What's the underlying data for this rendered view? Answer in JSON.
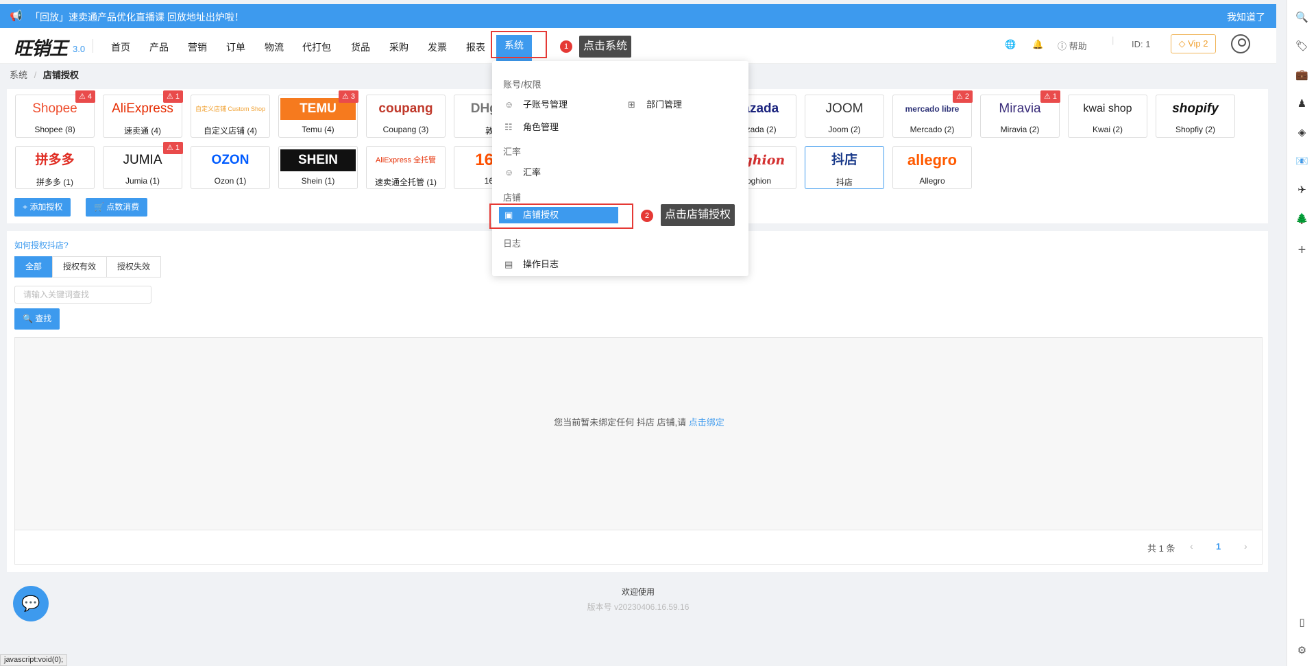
{
  "announcement": {
    "text": "「回放」速卖通产品优化直播课 回放地址出炉啦！",
    "close_label": "我知道了"
  },
  "nav": {
    "logo_text": "旺销王",
    "version": "3.0",
    "items": [
      "首页",
      "产品",
      "营销",
      "订单",
      "物流",
      "代打包",
      "货品",
      "采购",
      "发票",
      "报表",
      "系统"
    ],
    "help_label": "帮助",
    "user_id": "ID: 1",
    "vip_label": "Vip 2"
  },
  "breadcrumb": {
    "root": "系统",
    "current": "店铺授权"
  },
  "shops": [
    {
      "logo": "Shopee",
      "name": "Shopee (8)",
      "badge": "4",
      "color": "#ee4d2d"
    },
    {
      "logo": "AliExpress",
      "name": "速卖通 (4)",
      "badge": "1",
      "color": "#e62e04"
    },
    {
      "logo": "自定义店铺 Custom Shop",
      "name": "自定义店铺 (4)",
      "badge": "",
      "color": "#f0a030"
    },
    {
      "logo": "TEMU",
      "name": "Temu (4)",
      "badge": "3",
      "color": "#ffffff"
    },
    {
      "logo": "coupang",
      "name": "Coupang (3)",
      "badge": "",
      "color": "#c0392b"
    },
    {
      "logo": "DHgate",
      "name": "敦煌",
      "badge": "",
      "color": "#777777"
    },
    {
      "logo": "Lazada",
      "name": "Lazada (2)",
      "badge": "",
      "color": "#1a237e"
    },
    {
      "logo": "JOOM",
      "name": "Joom (2)",
      "badge": "",
      "color": "#333333"
    },
    {
      "logo": "mercado libre",
      "name": "Mercado (2)",
      "badge": "2",
      "color": "#2d3277"
    },
    {
      "logo": "Miravia",
      "name": "Miravia (2)",
      "badge": "1",
      "color": "#3a2d7a"
    },
    {
      "logo": "kwai shop",
      "name": "Kwai (2)",
      "badge": "",
      "color": "#222222"
    },
    {
      "logo": "shopify",
      "name": "Shopfiy (2)",
      "badge": "",
      "color": "#111111"
    },
    {
      "logo": "拼多多",
      "name": "拼多多 (1)",
      "badge": "",
      "color": "#e02e24"
    },
    {
      "logo": "JUMIA",
      "name": "Jumia (1)",
      "badge": "1",
      "color": "#111111"
    },
    {
      "logo": "OZON",
      "name": "Ozon (1)",
      "badge": "",
      "color": "#005bff"
    },
    {
      "logo": "SHEIN",
      "name": "Shein (1)",
      "badge": "",
      "color": "#ffffff"
    },
    {
      "logo": "AliExpress 全托管",
      "name": "速卖通全托管 (1)",
      "badge": "",
      "color": "#e62e04"
    },
    {
      "logo": "1688",
      "name": "1688",
      "badge": "",
      "color": "#ff5000"
    },
    {
      "logo": "Joghion",
      "name": "Joghion",
      "badge": "",
      "color": "#d32f2f"
    },
    {
      "logo": "抖店",
      "name": "抖店",
      "badge": "",
      "color": "#1a3a8a"
    },
    {
      "logo": "allegro",
      "name": "Allegro",
      "badge": "",
      "color": "#ff5a00"
    }
  ],
  "actions": {
    "add_auth": "添加授权",
    "points": "点数消费"
  },
  "howto": "如何授权抖店?",
  "tabs": [
    "全部",
    "授权有效",
    "授权失效"
  ],
  "search": {
    "placeholder": "请输入关键词查找",
    "button": "查找"
  },
  "empty": {
    "text": "您当前暂未绑定任何 抖店 店铺,请 ",
    "link": "点击绑定"
  },
  "pager": {
    "total": "共 1 条",
    "page": "1"
  },
  "footer": {
    "welcome": "欢迎使用",
    "version": "版本号 v20230406.16.59.16"
  },
  "status_bar": "javascript:void(0);",
  "dropdown": {
    "groups": [
      {
        "title": "账号/权限",
        "items": [
          "子账号管理",
          "部门管理",
          "角色管理"
        ]
      },
      {
        "title": "汇率",
        "items": [
          "汇率"
        ]
      },
      {
        "title": "店铺",
        "items": [
          "店铺授权"
        ]
      },
      {
        "title": "日志",
        "items": [
          "操作日志"
        ]
      }
    ]
  },
  "annotations": {
    "step1_num": "1",
    "step1": "点击系统",
    "step2_num": "2",
    "step2": "点击店铺授权"
  }
}
